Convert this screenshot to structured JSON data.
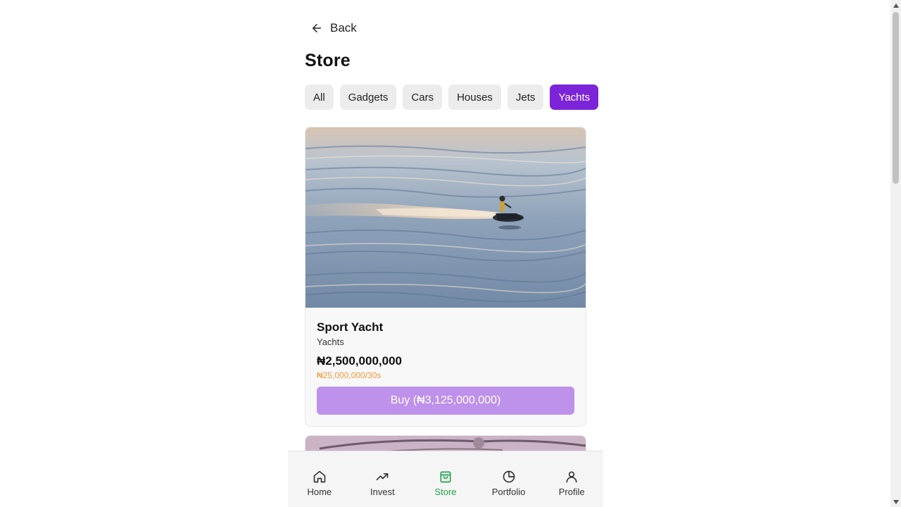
{
  "header": {
    "back_label": "Back",
    "title": "Store"
  },
  "filters": [
    {
      "label": "All",
      "active": false
    },
    {
      "label": "Gadgets",
      "active": false
    },
    {
      "label": "Cars",
      "active": false
    },
    {
      "label": "Houses",
      "active": false
    },
    {
      "label": "Jets",
      "active": false
    },
    {
      "label": "Yachts",
      "active": true
    }
  ],
  "products": [
    {
      "name": "Sport Yacht",
      "category": "Yachts",
      "price": "₦2,500,000,000",
      "yield": "₦25,000,000/30s",
      "buy_label": "Buy (₦3,125,000,000)",
      "image": "jet-ski-on-water-photo"
    }
  ],
  "nav": {
    "items": [
      {
        "label": "Home",
        "icon": "home-icon",
        "active": false
      },
      {
        "label": "Invest",
        "icon": "trending-up-icon",
        "active": false
      },
      {
        "label": "Store",
        "icon": "shopping-bag-icon",
        "active": true
      },
      {
        "label": "Portfolio",
        "icon": "pie-chart-icon",
        "active": false
      },
      {
        "label": "Profile",
        "icon": "user-icon",
        "active": false
      }
    ]
  },
  "colors": {
    "accent": "#7c24d9",
    "buy_button": "#be91ea",
    "yield_text": "#f39a3a",
    "nav_active": "#1fa34a"
  }
}
